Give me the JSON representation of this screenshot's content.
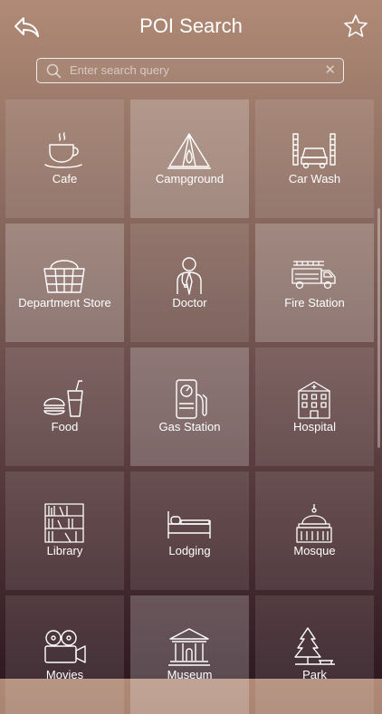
{
  "header": {
    "title": "POI Search"
  },
  "search": {
    "placeholder": "Enter search query",
    "value": "",
    "clear_glyph": "✕"
  },
  "categories": [
    {
      "label": "Cafe",
      "icon": "coffee-cup-icon"
    },
    {
      "label": "Campground",
      "icon": "tent-icon"
    },
    {
      "label": "Car Wash",
      "icon": "car-wash-icon"
    },
    {
      "label": "Department Store",
      "icon": "shopping-basket-icon"
    },
    {
      "label": "Doctor",
      "icon": "doctor-icon"
    },
    {
      "label": "Fire Station",
      "icon": "fire-truck-icon"
    },
    {
      "label": "Food",
      "icon": "burger-drink-icon"
    },
    {
      "label": "Gas Station",
      "icon": "fuel-pump-icon"
    },
    {
      "label": "Hospital",
      "icon": "hospital-building-icon"
    },
    {
      "label": "Library",
      "icon": "bookshelf-icon"
    },
    {
      "label": "Lodging",
      "icon": "bed-icon"
    },
    {
      "label": "Mosque",
      "icon": "domed-building-icon"
    },
    {
      "label": "Movies",
      "icon": "film-camera-icon"
    },
    {
      "label": "Museum",
      "icon": "museum-icon"
    },
    {
      "label": "Park",
      "icon": "tree-icon"
    }
  ]
}
